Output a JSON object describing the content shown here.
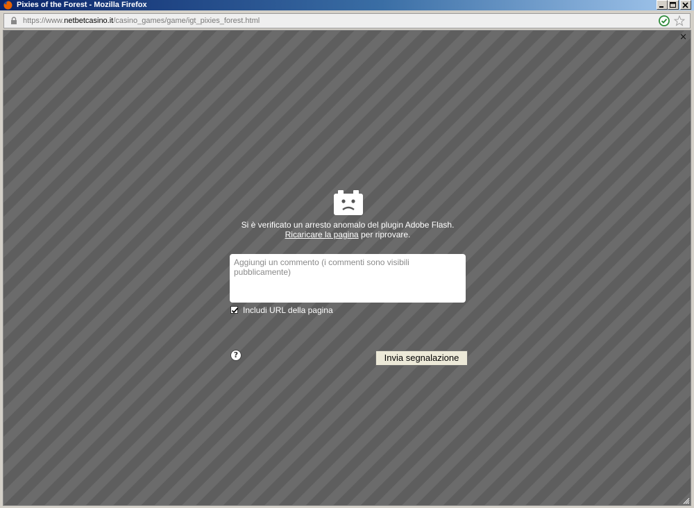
{
  "window": {
    "title": "Pixies of the Forest - Mozilla Firefox",
    "icon": "firefox-icon",
    "controls": [
      "minimize-icon",
      "maximize-icon",
      "close-icon"
    ]
  },
  "address": {
    "prefix": "https://www.",
    "domain": "netbetcasino.it",
    "path": "/casino_games/game/igt_pixies_forest.html",
    "lock_icon": "lock-icon",
    "verified_icon": "check-circle-icon",
    "bookmark_icon": "star-icon"
  },
  "crash": {
    "icon": "sad-plugin-icon",
    "message": "Si è verificato un arresto anomalo del plugin Adobe Flash.",
    "reload_link": "Ricaricare la pagina",
    "reload_suffix": " per riprovare.",
    "comment_placeholder": "Aggiungi un commento (i commenti sono visibili pubblicamente)",
    "include_url_label": "Includi URL della pagina",
    "include_url_checked": true,
    "help_symbol": "?",
    "submit_label": "Invia segnalazione"
  },
  "content": {
    "dismiss_symbol": "×"
  },
  "colors": {
    "titlebar": "#0a246a",
    "background_stripe_a": "#6b6b6b",
    "background_stripe_b": "#5e5e5e"
  }
}
